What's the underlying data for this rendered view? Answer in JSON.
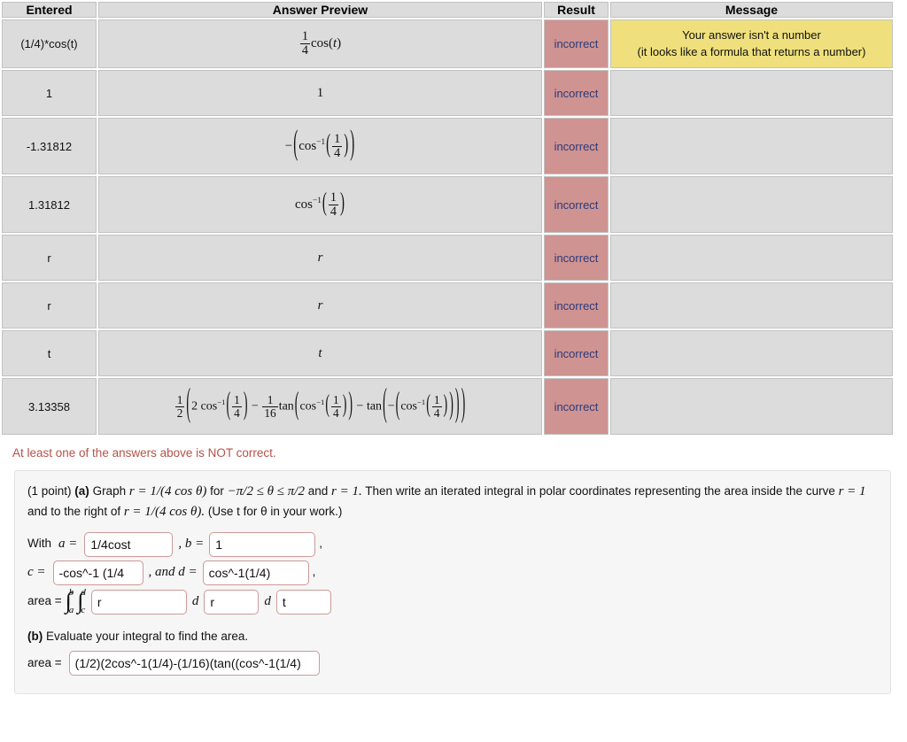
{
  "table": {
    "headers": [
      "Entered",
      "Answer Preview",
      "Result",
      "Message"
    ],
    "rows": [
      {
        "entered": "(1/4)*cos(t)",
        "preview_kind": "quarter_cos_t",
        "result": "incorrect",
        "message_line1": "Your answer isn't a number",
        "message_line2": "(it looks like a formula that returns a number)"
      },
      {
        "entered": "1",
        "preview_kind": "one",
        "preview_text": "1",
        "result": "incorrect",
        "message_line1": "",
        "message_line2": ""
      },
      {
        "entered": "-1.31812",
        "preview_kind": "neg_arccos_quarter",
        "result": "incorrect",
        "message_line1": "",
        "message_line2": ""
      },
      {
        "entered": "1.31812",
        "preview_kind": "arccos_quarter",
        "result": "incorrect",
        "message_line1": "",
        "message_line2": ""
      },
      {
        "entered": "r",
        "preview_kind": "var",
        "preview_text": "r",
        "result": "incorrect",
        "message_line1": "",
        "message_line2": ""
      },
      {
        "entered": "r",
        "preview_kind": "var",
        "preview_text": "r",
        "result": "incorrect",
        "message_line1": "",
        "message_line2": ""
      },
      {
        "entered": "t",
        "preview_kind": "var",
        "preview_text": "t",
        "result": "incorrect",
        "message_line1": "",
        "message_line2": ""
      },
      {
        "entered": "3.13358",
        "preview_kind": "big_area_expression",
        "result": "incorrect",
        "message_line1": "",
        "message_line2": ""
      }
    ]
  },
  "warning": "At least one of the answers above is NOT correct.",
  "problem": {
    "points": "(1 point)",
    "part_a_label": "(a)",
    "statement_1": "Graph",
    "statement_eq1": "r = 1/(4 cos θ)",
    "statement_2": "for",
    "statement_eq2": "−π/2 ≤ θ ≤ π/2",
    "statement_3": "and",
    "statement_eq3": "r = 1.",
    "statement_4": "Then write an iterated integral in polar coordinates representing the area inside the curve",
    "statement_eq4": "r = 1",
    "statement_5": "and to the right of",
    "statement_eq5": "r = 1/(4 cos θ).",
    "statement_6": "(Use t for θ in your work.)",
    "with_label": "With",
    "a_label": "a =",
    "a_value": "1/4cost",
    "b_label": ", b =",
    "b_value": "1",
    "comma1": ",",
    "c_label": "c =",
    "c_value": "-cos^-1 (1/4",
    "d_label": ", and d =",
    "d_value": "cos^-1(1/4)",
    "comma2": ",",
    "area_label": "area =",
    "integrand_value": "r",
    "d_first": "d",
    "d_first_value": "r",
    "d_second": "d",
    "d_second_value": "t",
    "limit_upper_outer": "b",
    "limit_lower_outer": "a",
    "limit_upper_inner": "d",
    "limit_lower_inner": "c",
    "part_b_label": "(b)",
    "part_b_text": "Evaluate your integral to find the area.",
    "area_b_label": "area =",
    "area_b_value": "(1/2)(2cos^-1(1/4)-(1/16)(tan((cos^-1(1/4)"
  },
  "colors": {
    "incorrect_bg": "#cf9391",
    "incorrect_text": "#2b3a7b",
    "message_bg": "#efe07d",
    "cell_bg": "#dcdcdc",
    "warning_text": "#b5524a",
    "input_border": "#cd9a97",
    "panel_bg": "#f6f6f6"
  }
}
